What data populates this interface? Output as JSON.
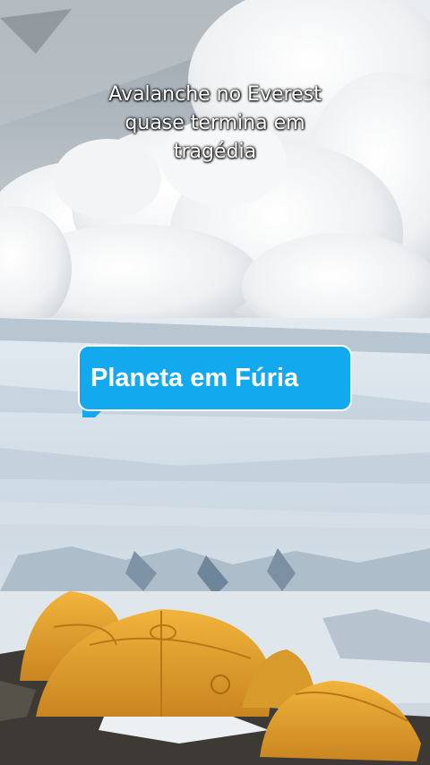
{
  "caption": {
    "line1": "Avalanche no Everest",
    "line2": "quase termina em",
    "line3": "tragédia"
  },
  "badge": {
    "text": "Planeta em Fúria",
    "color": "#12a9ee"
  },
  "scene": {
    "subject": "avalanche-cloud-over-glacier-with-orange-tents",
    "tent_color": "#e9a531"
  }
}
